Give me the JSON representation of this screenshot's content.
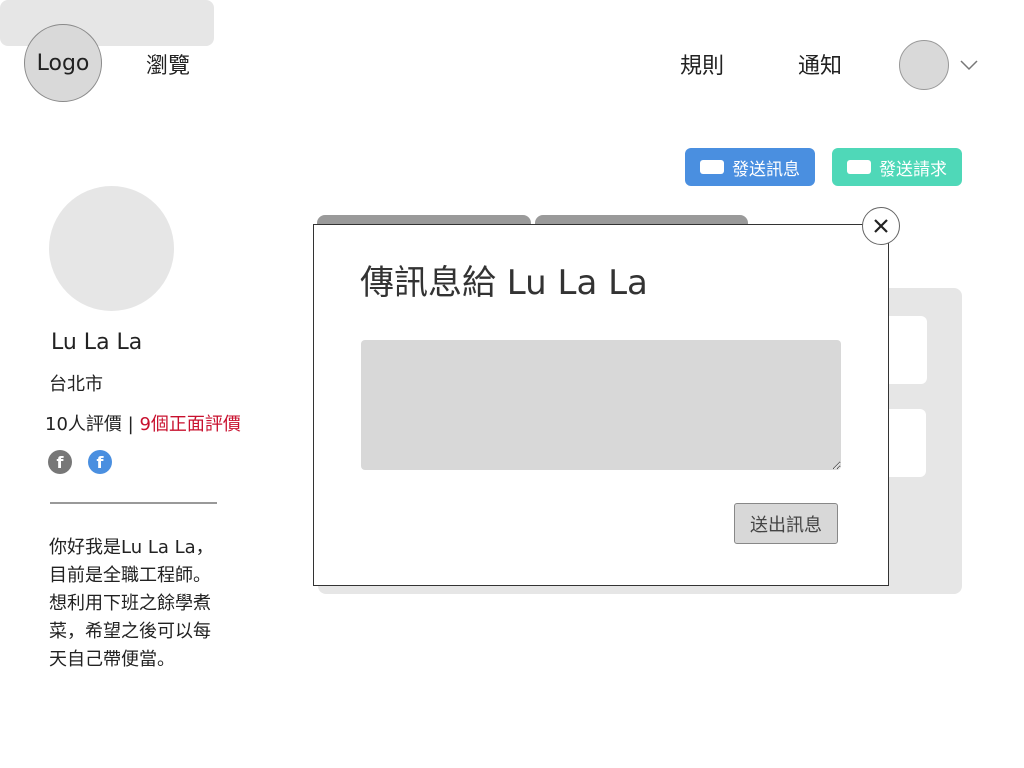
{
  "header": {
    "logo": "Logo",
    "nav_browse": "瀏覽",
    "nav_rules": "規則",
    "nav_notice": "通知"
  },
  "actions": {
    "send_message": "發送訊息",
    "send_request": "發送請求"
  },
  "profile": {
    "name": "Lu La La",
    "city": "台北市",
    "reviews_count": "10人評價",
    "reviews_sep": "|",
    "reviews_positive": "9個正面評價",
    "bio": "你好我是Lu La La，目前是全職工程師。想利用下班之餘學煮菜，希望之後可以每天自己帶便當。"
  },
  "modal": {
    "title": "傳訊息給 Lu La La",
    "message_value": "",
    "submit": "送出訊息"
  },
  "colors": {
    "send_message_bg": "#4a8fe0",
    "send_request_bg": "#4fd8b8",
    "positive_reviews": "#c8102e"
  },
  "icons": {
    "close": "close-icon",
    "chevron": "chevron-down-icon",
    "facebook": "facebook-icon",
    "envelope": "envelope-icon"
  }
}
